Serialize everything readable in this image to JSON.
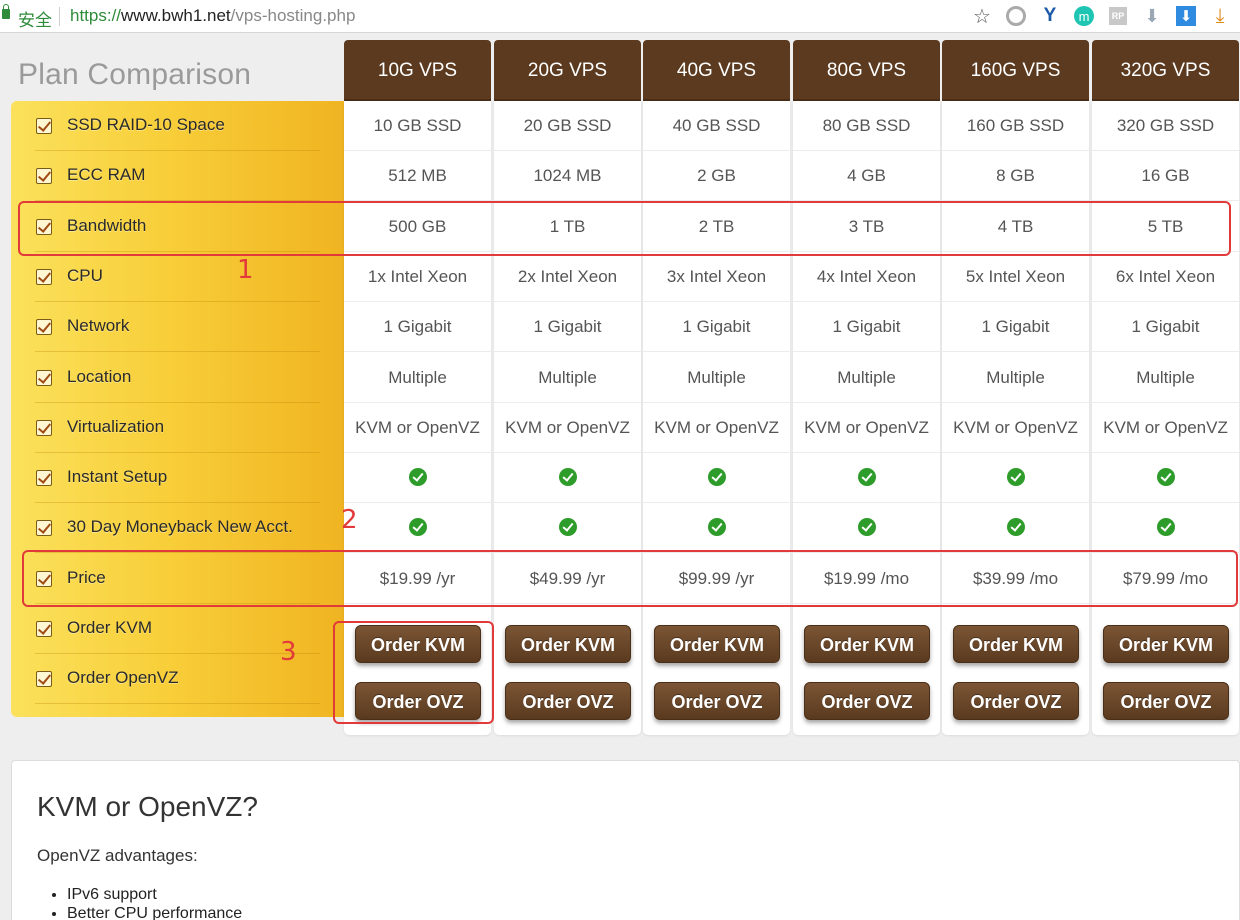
{
  "browser": {
    "secure_label": "安全",
    "url_scheme": "https://",
    "url_host": "www.bwh1.net",
    "url_path": "/vps-hosting.php",
    "toolbar_icons": [
      "star-icon",
      "extension-g-icon",
      "extension-y-icon",
      "extension-m-icon",
      "extension-rp-icon",
      "download-arrow-icon",
      "download-box-icon",
      "download-tray-icon"
    ]
  },
  "page_title": "Plan Comparison",
  "features": [
    "SSD RAID-10 Space",
    "ECC RAM",
    "Bandwidth",
    "CPU",
    "Network",
    "Location",
    "Virtualization",
    "Instant Setup",
    "30 Day Moneyback New Acct.",
    "Price",
    "Order KVM",
    "Order OpenVZ"
  ],
  "plans": [
    {
      "name": "10G VPS",
      "ssd": "10 GB SSD",
      "ram": "512 MB",
      "bandwidth": "500 GB",
      "cpu": "1x Intel Xeon",
      "network": "1 Gigabit",
      "location": "Multiple",
      "virt": "KVM or OpenVZ",
      "price": "$19.99 /yr"
    },
    {
      "name": "20G VPS",
      "ssd": "20 GB SSD",
      "ram": "1024 MB",
      "bandwidth": "1 TB",
      "cpu": "2x Intel Xeon",
      "network": "1 Gigabit",
      "location": "Multiple",
      "virt": "KVM or OpenVZ",
      "price": "$49.99 /yr"
    },
    {
      "name": "40G VPS",
      "ssd": "40 GB SSD",
      "ram": "2 GB",
      "bandwidth": "2 TB",
      "cpu": "3x Intel Xeon",
      "network": "1 Gigabit",
      "location": "Multiple",
      "virt": "KVM or OpenVZ",
      "price": "$99.99 /yr"
    },
    {
      "name": "80G VPS",
      "ssd": "80 GB SSD",
      "ram": "4 GB",
      "bandwidth": "3 TB",
      "cpu": "4x Intel Xeon",
      "network": "1 Gigabit",
      "location": "Multiple",
      "virt": "KVM or OpenVZ",
      "price": "$19.99 /mo"
    },
    {
      "name": "160G VPS",
      "ssd": "160 GB SSD",
      "ram": "8 GB",
      "bandwidth": "4 TB",
      "cpu": "5x Intel Xeon",
      "network": "1 Gigabit",
      "location": "Multiple",
      "virt": "KVM or OpenVZ",
      "price": "$39.99 /mo"
    },
    {
      "name": "320G VPS",
      "ssd": "320 GB SSD",
      "ram": "16 GB",
      "bandwidth": "5 TB",
      "cpu": "6x Intel Xeon",
      "network": "1 Gigabit",
      "location": "Multiple",
      "virt": "KVM or OpenVZ",
      "price": "$79.99 /mo"
    }
  ],
  "buttons": {
    "order_kvm": "Order KVM",
    "order_ovz": "Order OVZ"
  },
  "annotations": [
    "1",
    "2",
    "3"
  ],
  "annotation_color": "#e23a3a",
  "brand_brown": "#5b3a1f",
  "info": {
    "heading": "KVM or OpenVZ?",
    "subheading": "OpenVZ advantages:",
    "bullets": [
      "IPv6 support",
      "Better CPU performance"
    ]
  }
}
